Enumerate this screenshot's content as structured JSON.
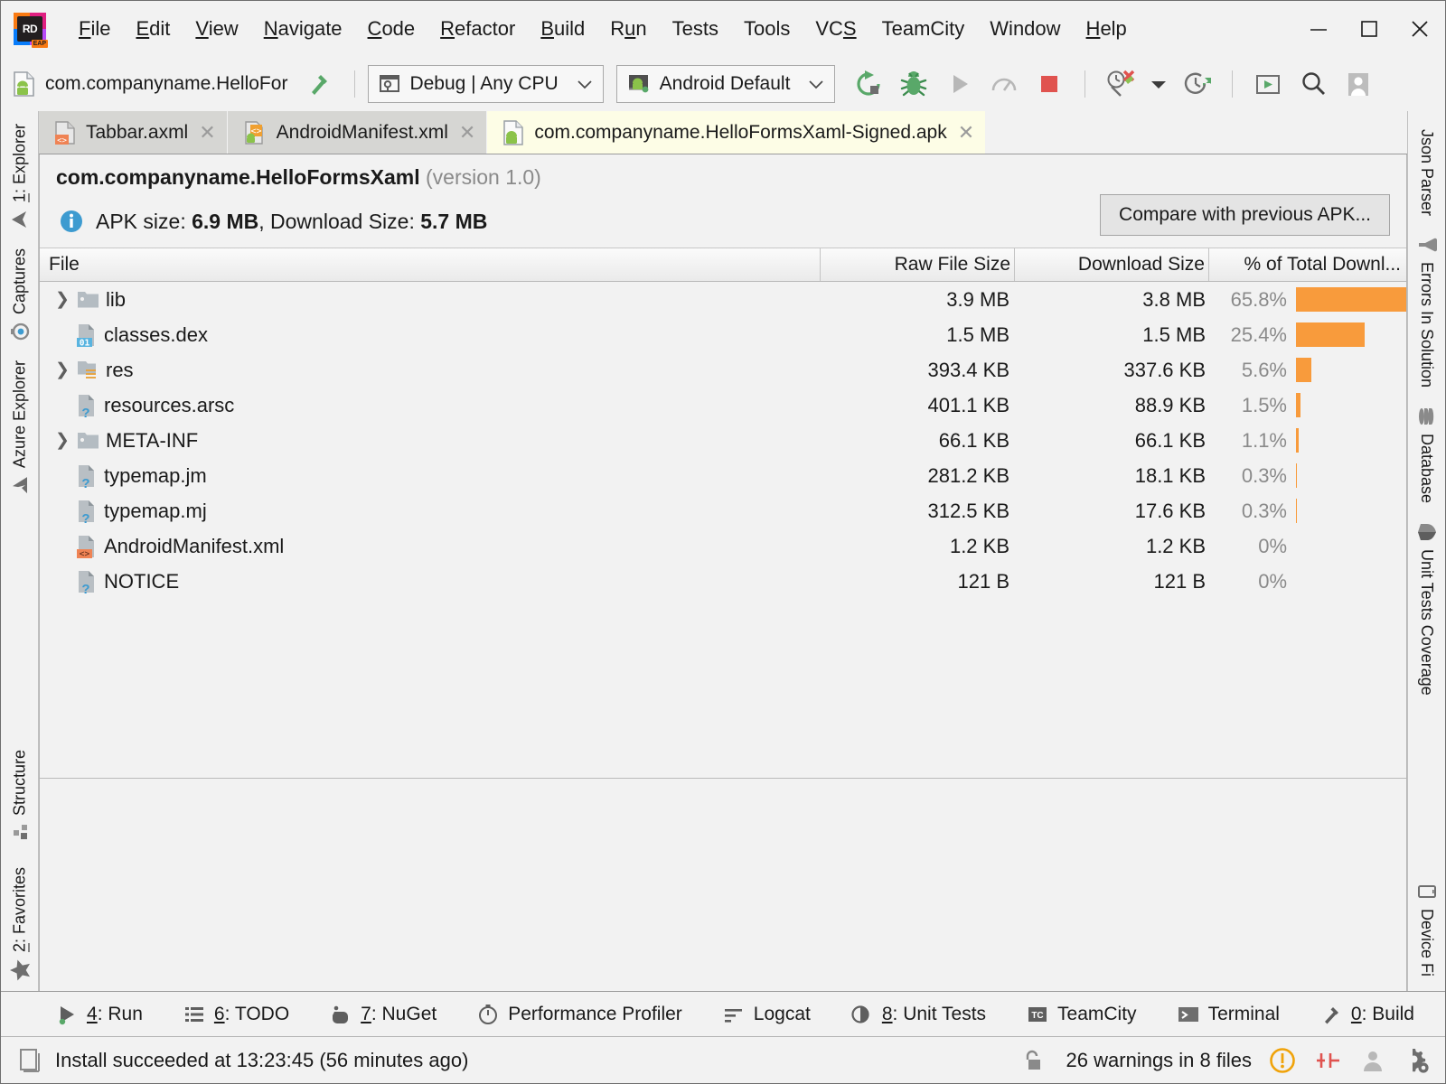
{
  "window": {
    "controls": {
      "minimize": "minimize-button",
      "maximize": "maximize-button",
      "close": "close-button"
    }
  },
  "menubar": {
    "logo_text": "RD",
    "logo_badge": "EAP",
    "items": [
      {
        "label": "File",
        "mnemonic": "F"
      },
      {
        "label": "Edit",
        "mnemonic": "E"
      },
      {
        "label": "View",
        "mnemonic": "V"
      },
      {
        "label": "Navigate",
        "mnemonic": "N"
      },
      {
        "label": "Code",
        "mnemonic": "C"
      },
      {
        "label": "Refactor",
        "mnemonic": "R"
      },
      {
        "label": "Build",
        "mnemonic": "B"
      },
      {
        "label": "Run",
        "mnemonic": "u"
      },
      {
        "label": "Tests",
        "mnemonic": ""
      },
      {
        "label": "Tools",
        "mnemonic": ""
      },
      {
        "label": "VCS",
        "mnemonic": "S"
      },
      {
        "label": "TeamCity",
        "mnemonic": ""
      },
      {
        "label": "Window",
        "mnemonic": ""
      },
      {
        "label": "Help",
        "mnemonic": "H"
      }
    ]
  },
  "toolbar": {
    "project_name": "com.companyname.HelloFor",
    "project_icon": "android-file-icon",
    "build_icon": "hammer-icon",
    "config_combo": {
      "label": "Debug | Any CPU",
      "icon": "wrench-config-icon"
    },
    "device_combo": {
      "label": "Android Default",
      "icon": "android-device-icon"
    },
    "icons": [
      "rerun-icon",
      "debug-icon",
      "run-icon",
      "profile-icon",
      "stop-icon",
      "coverage-icon",
      "dropdown-arrow-icon",
      "history-icon",
      "open-toolwindow-icon",
      "search-icon",
      "account-icon"
    ]
  },
  "tabs": [
    {
      "label": "Tabbar.axml",
      "icon": "axml-file-icon",
      "active": false,
      "closable": true
    },
    {
      "label": "AndroidManifest.xml",
      "icon": "manifest-file-icon",
      "active": false,
      "closable": true
    },
    {
      "label": "com.companyname.HelloFormsXaml-Signed.apk",
      "icon": "apk-file-icon",
      "active": true,
      "closable": true
    }
  ],
  "apk": {
    "package_name": "com.companyname.HelloFormsXaml",
    "version_text": "(version 1.0)",
    "info_icon": "info-icon",
    "size_prefix": "APK size: ",
    "apk_size": "6.9 MB",
    "size_middle": ", Download Size: ",
    "download_size": "5.7 MB",
    "compare_button": "Compare with previous APK...",
    "accent_bar_color": "#f89b3c",
    "columns": [
      "File",
      "Raw File Size",
      "Download Size",
      "% of Total Downl..."
    ],
    "rows": [
      {
        "name": "lib",
        "icon": "folder-icon",
        "expandable": true,
        "raw": "3.9 MB",
        "download": "3.8 MB",
        "percent": "65.8%",
        "bar": 65.8
      },
      {
        "name": "classes.dex",
        "icon": "dex-file-icon",
        "expandable": false,
        "raw": "1.5 MB",
        "download": "1.5 MB",
        "percent": "25.4%",
        "bar": 25.4
      },
      {
        "name": "res",
        "icon": "res-folder-icon",
        "expandable": true,
        "raw": "393.4 KB",
        "download": "337.6 KB",
        "percent": "5.6%",
        "bar": 5.6
      },
      {
        "name": "resources.arsc",
        "icon": "unknown-file-icon",
        "expandable": false,
        "raw": "401.1 KB",
        "download": "88.9 KB",
        "percent": "1.5%",
        "bar": 1.5
      },
      {
        "name": "META-INF",
        "icon": "folder-icon",
        "expandable": true,
        "raw": "66.1 KB",
        "download": "66.1 KB",
        "percent": "1.1%",
        "bar": 1.1
      },
      {
        "name": "typemap.jm",
        "icon": "unknown-file-icon",
        "expandable": false,
        "raw": "281.2 KB",
        "download": "18.1 KB",
        "percent": "0.3%",
        "bar": 0.3
      },
      {
        "name": "typemap.mj",
        "icon": "unknown-file-icon",
        "expandable": false,
        "raw": "312.5 KB",
        "download": "17.6 KB",
        "percent": "0.3%",
        "bar": 0.3
      },
      {
        "name": "AndroidManifest.xml",
        "icon": "xml-file-icon",
        "expandable": false,
        "raw": "1.2 KB",
        "download": "1.2 KB",
        "percent": "0%",
        "bar": 0
      },
      {
        "name": "NOTICE",
        "icon": "unknown-file-icon",
        "expandable": false,
        "raw": "121 B",
        "download": "121 B",
        "percent": "0%",
        "bar": 0
      }
    ]
  },
  "left_stripe": {
    "top": [
      {
        "label": "1: Explorer",
        "icon": "explorer-icon",
        "mnemonic": "1"
      },
      {
        "label": "Captures",
        "icon": "captures-icon",
        "mnemonic": ""
      },
      {
        "label": "Azure Explorer",
        "icon": "azure-icon",
        "mnemonic": ""
      }
    ],
    "bottom": [
      {
        "label": "Structure",
        "icon": "structure-icon",
        "mnemonic": ""
      },
      {
        "label": "2: Favorites",
        "icon": "favorites-star-icon",
        "mnemonic": "2"
      }
    ]
  },
  "right_stripe": {
    "top": [
      {
        "label": "Json Parser",
        "icon": "json-parser-icon"
      },
      {
        "label": "Errors In Solution",
        "icon": "errors-icon"
      },
      {
        "label": "Database",
        "icon": "database-icon"
      },
      {
        "label": "Unit Tests Coverage",
        "icon": "coverage-shield-icon"
      }
    ],
    "bottom": [
      {
        "label": "Device Fi",
        "icon": "device-file-explorer-icon"
      }
    ]
  },
  "bottom_bar": [
    {
      "label": "4: Run",
      "icon": "run-icon",
      "mnemonic": "4"
    },
    {
      "label": "6: TODO",
      "icon": "todo-icon",
      "mnemonic": "6"
    },
    {
      "label": "7: NuGet",
      "icon": "nuget-icon",
      "mnemonic": "7"
    },
    {
      "label": "Performance Profiler",
      "icon": "profiler-icon",
      "mnemonic": ""
    },
    {
      "label": "Logcat",
      "icon": "logcat-icon",
      "mnemonic": ""
    },
    {
      "label": "8: Unit Tests",
      "icon": "unit-tests-icon",
      "mnemonic": "8"
    },
    {
      "label": "TeamCity",
      "icon": "teamcity-icon",
      "mnemonic": ""
    },
    {
      "label": "Terminal",
      "icon": "terminal-icon",
      "mnemonic": ""
    },
    {
      "label": "0: Build",
      "icon": "build-hammer-icon",
      "mnemonic": "0"
    }
  ],
  "statusbar": {
    "message_icon": "device-icon",
    "message": "Install succeeded at 13:23:45 (56 minutes ago)",
    "lock_icon": "unlock-icon",
    "warnings": "26 warnings in 8 files",
    "warning_icon": "warning-circle-icon",
    "inspection_icon": "inspection-widget-icon",
    "user_icon": "user-icon",
    "settings_icon": "gear-icon"
  }
}
